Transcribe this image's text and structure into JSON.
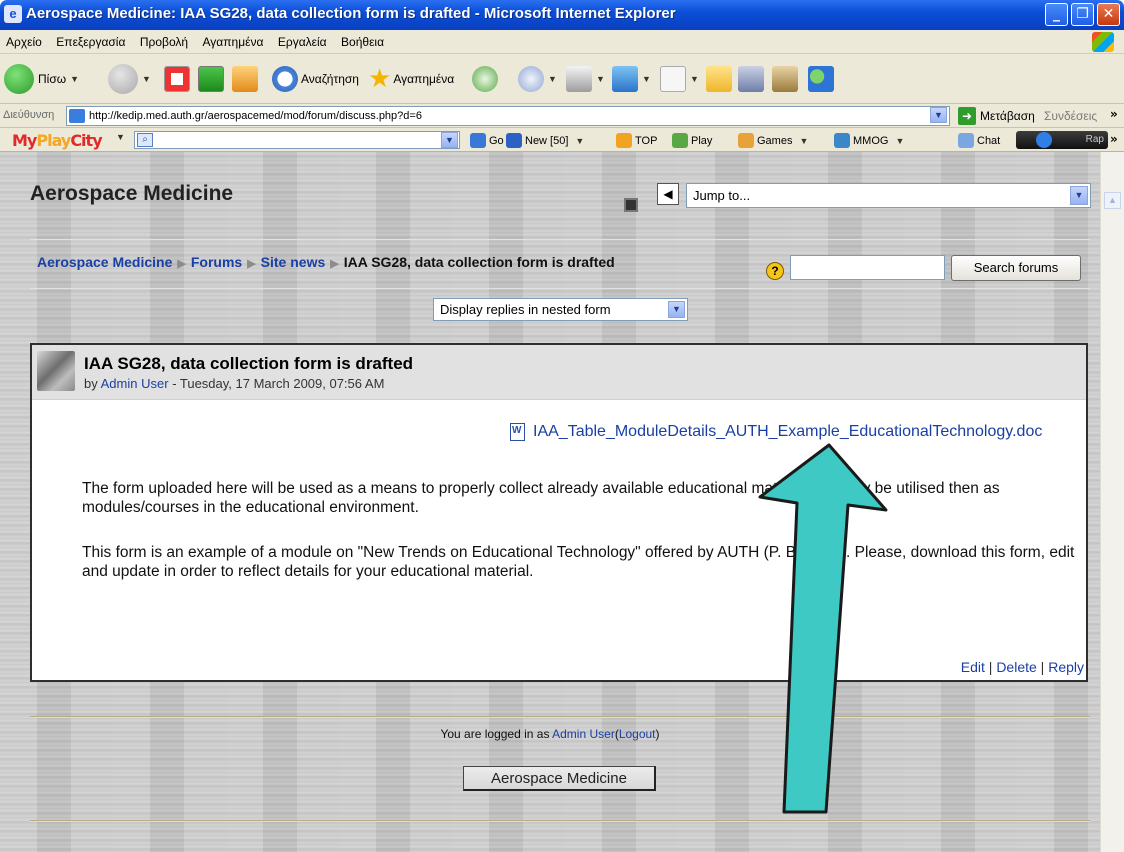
{
  "window": {
    "title": "Aerospace Medicine: IAA SG28, data collection form is drafted - Microsoft Internet Explorer",
    "minimize": "_",
    "maximize": "❐",
    "close": "✕"
  },
  "menu": [
    "Αρχείο",
    "Επεξεργασία",
    "Προβολή",
    "Αγαπημένα",
    "Εργαλεία",
    "Βοήθεια"
  ],
  "toolbar": {
    "back_label": "Πίσω",
    "search_label": "Αναζήτηση",
    "favorites_label": "Αγαπημένα"
  },
  "address": {
    "label": "Διεύθυνση",
    "url": "http://kedip.med.auth.gr/aerospacemed/mod/forum/discuss.php?d=6",
    "go_label": "Μετάβαση",
    "links_label": "Συνδέσεις",
    "more": "»"
  },
  "mpc": {
    "go": "Go",
    "new": "New [50]",
    "top": "TOP",
    "play": "Play",
    "games": "Games",
    "mmog": "MMOG",
    "chat": "Chat",
    "radio": "Rap",
    "more": "»"
  },
  "page": {
    "site_title": "Aerospace Medicine",
    "jump_to": "Jump to...",
    "breadcrumb": [
      "Aerospace Medicine",
      "Forums",
      "Site news",
      "IAA SG28, data collection form is drafted"
    ],
    "search_button": "Search forums",
    "display_mode": "Display replies in nested form",
    "post": {
      "subject": "IAA SG28, data collection form is drafted",
      "by": "by",
      "author": "Admin User",
      "date": "- Tuesday, 17 March 2009, 07:56 AM",
      "attachment": "IAA_Table_ModuleDetails_AUTH_Example_EducationalTechnology.doc",
      "paragraph1": "The form uploaded here will be used as a means to properly collect already available educational material that may be utilised then as modules/courses in the educational environment.",
      "paragraph2": "This form is an example of a module on \"New Trends on Educational Technology\" offered by AUTH (P. Bamidis). Please, download this form, edit and update in order to reflect details for your educational material.",
      "edit": "Edit",
      "delete": "Delete",
      "reply": "Reply",
      "sep": "|"
    },
    "logged_prefix": "You are logged in as",
    "logged_user": "Admin User",
    "logout": "Logout",
    "home_button": "Aerospace Medicine"
  },
  "colors": {
    "arrow_fill": "#3ec9c4",
    "arrow_stroke": "#1a1a1a",
    "link": "#1a3fa4"
  }
}
